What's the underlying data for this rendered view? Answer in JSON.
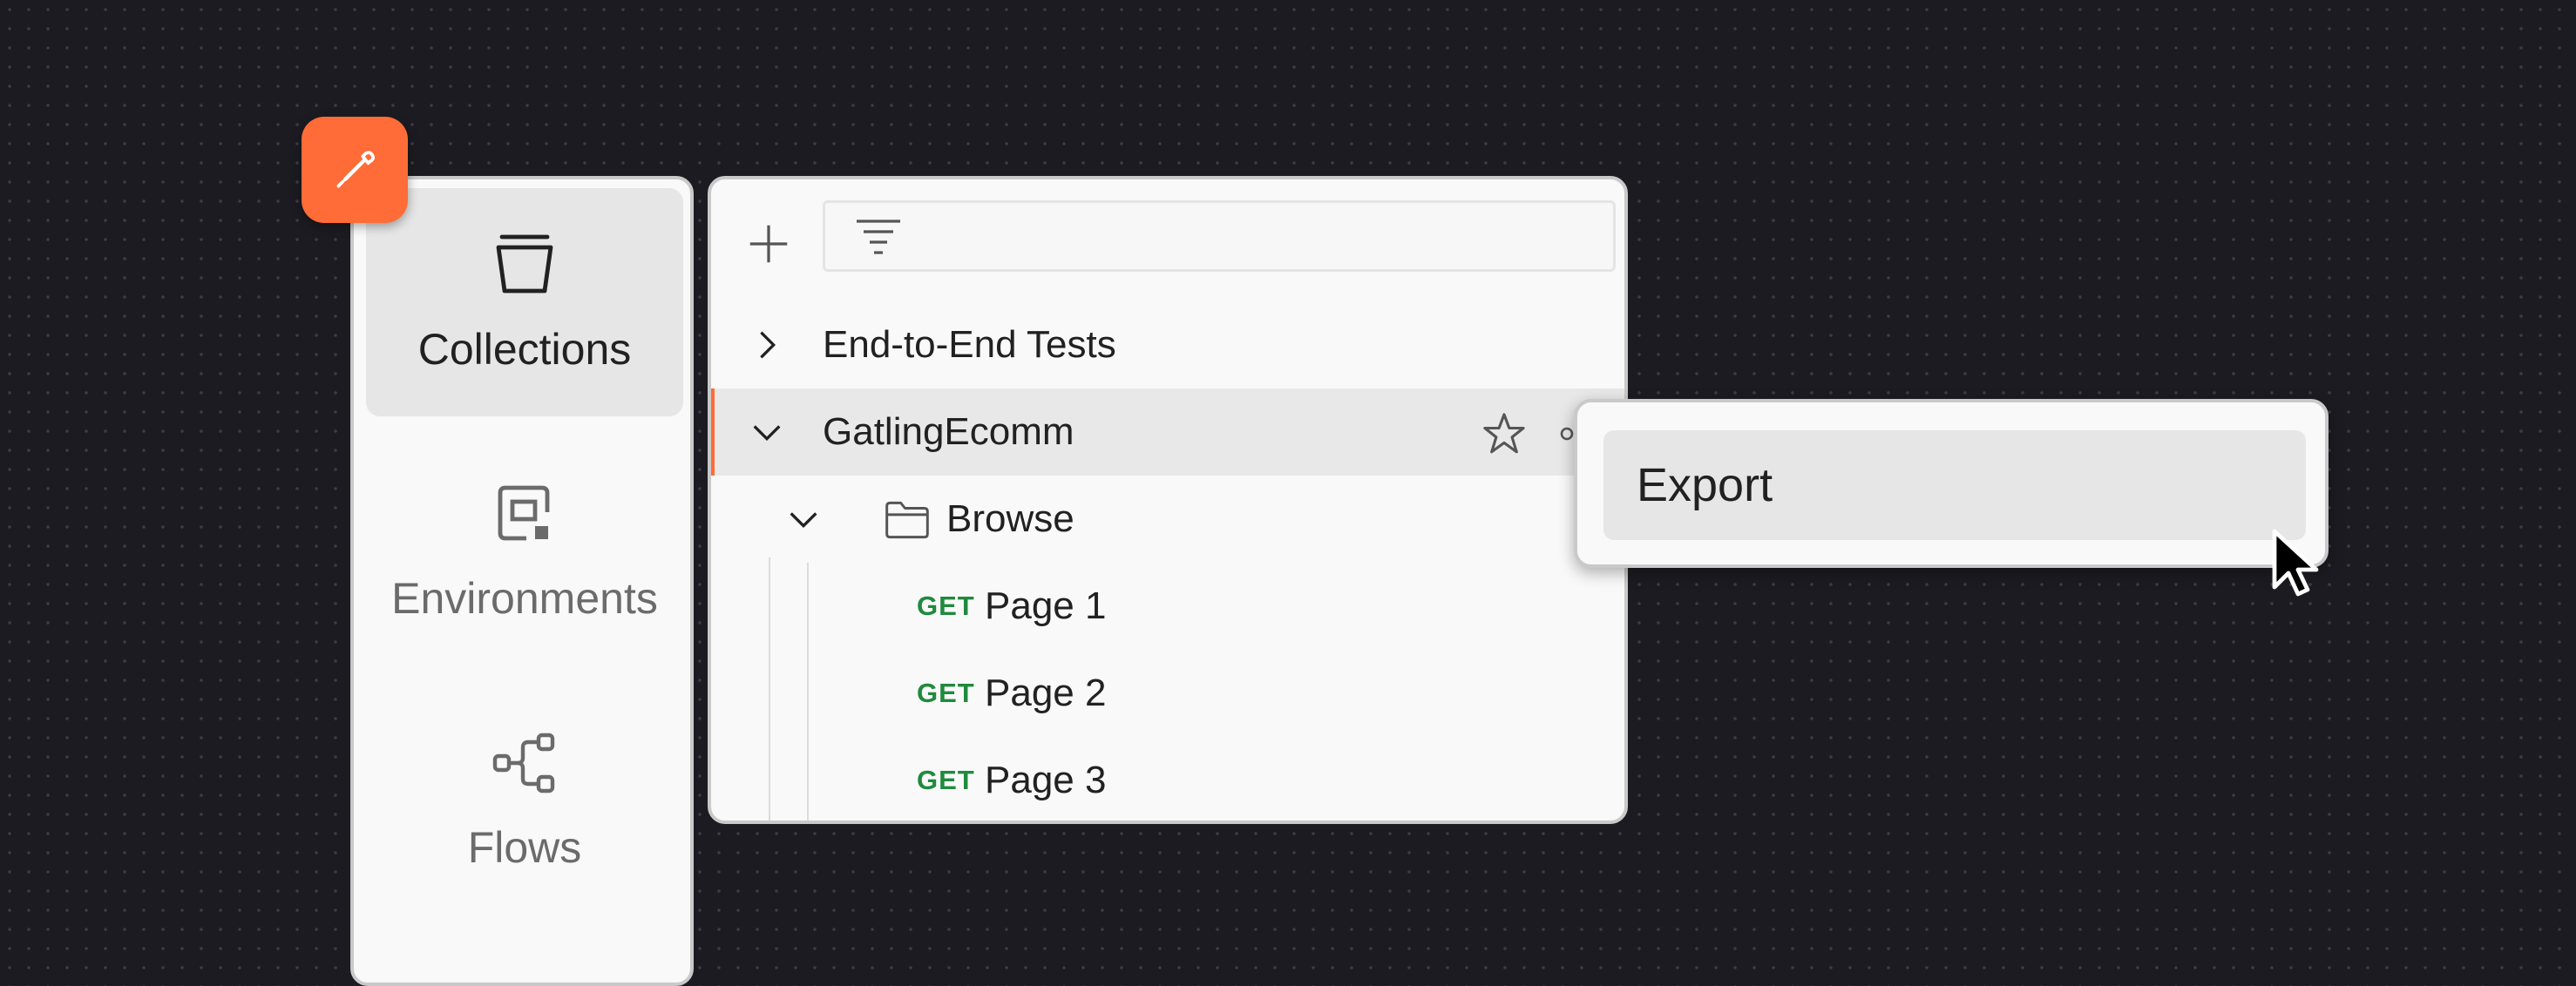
{
  "sidebar": {
    "items": [
      {
        "label": "Collections",
        "icon": "collections-icon",
        "active": true
      },
      {
        "label": "Environments",
        "icon": "environments-icon",
        "active": false
      },
      {
        "label": "Flows",
        "icon": "flows-icon",
        "active": false
      }
    ]
  },
  "logo": {
    "icon": "postman-logo-icon",
    "color": "#ff6c37"
  },
  "toolbar": {
    "add_icon": "plus-icon",
    "filter_icon": "filter-icon",
    "filter_placeholder": ""
  },
  "tree": {
    "collections": [
      {
        "label": "End-to-End Tests",
        "expanded": false
      },
      {
        "label": "GatlingEcomm",
        "expanded": true,
        "selected": true
      }
    ],
    "folder": {
      "label": "Browse",
      "expanded": true
    },
    "requests": [
      {
        "method": "GET",
        "label": "Page 1"
      },
      {
        "method": "GET",
        "label": "Page 2"
      },
      {
        "method": "GET",
        "label": "Page 3"
      }
    ]
  },
  "context_menu": {
    "items": [
      {
        "label": "Export"
      }
    ]
  },
  "colors": {
    "accent": "#ff6c37",
    "get_method": "#1f8a3d",
    "background": "#1c1b21"
  }
}
